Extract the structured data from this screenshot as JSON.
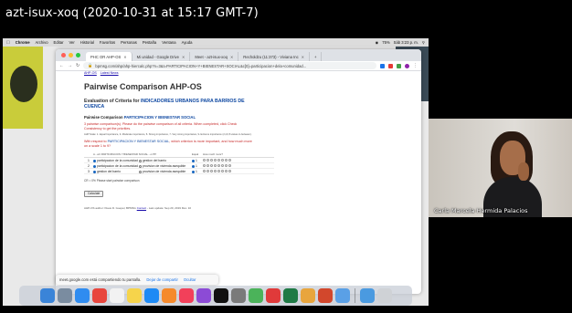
{
  "meeting": {
    "title": "azt-isux-xoq (2020-10-31 at 15:17 GMT-7)",
    "participant_name": "Carla Marcela Hermida Palacios"
  },
  "menubar": {
    "apple": "",
    "items": [
      "Chrome",
      "Archivo",
      "Editar",
      "Ver",
      "Historial",
      "Favoritos",
      "Personas",
      "Pestaña",
      "Ventana",
      "Ayuda"
    ],
    "clock": "Sáb 3:23 p. m.",
    "battery": "75%"
  },
  "browser": {
    "tabs": [
      {
        "label": "PHC OR AHP-OS",
        "active": true
      },
      {
        "label": "Mi unidad - Google Drive",
        "active": false
      },
      {
        "label": "Meet - azt-isux-xoq",
        "active": false
      },
      {
        "label": "Recholdzu (11:373) - Viviana Inc",
        "active": false
      }
    ],
    "new_tab": "+",
    "url": "bpmsg.com/ahp/ahp-hiercalc.php?n=3&t=PARTICIPACION+Y+BIENESTAR+SOCIAL&c[0]=participacion+dela+comunidad..."
  },
  "page": {
    "breadcrumbs": [
      "AHP-OS",
      "Latest News"
    ],
    "title": "Pairwise Comparison AHP-OS",
    "eval_prefix": "Evaluation of Criteria for ",
    "eval_topic": "INDICADORES URBANOS PARA BARRIOS DE CUENCA",
    "pc_prefix": "Pairwise Comparison ",
    "pc_topic": "PARTICIPACION Y BIENESTAR SOCIAL",
    "instructions": "3 pairwise comparison(s). Please do the pairwise comparison of all criteria. When completed, click Check Consistency to get the priorities.",
    "scale": "AHP Scale: 1- Equal Importance, 3- Moderate importance, 5- Strong importance, 7- Very strong importance, 9- Extreme importance (2,4,6,8 values in-between).",
    "question_prefix": "With respect to ",
    "question_topic": "PARTICIPACION Y BIENESTAR SOCIAL",
    "question_suffix": ", which criterion is more important, and how much more on a scale 1 to 9?",
    "table_headers": {
      "a": "A - wrt PARTICIPACION Y BIENESTAR SOCIAL - or B?",
      "eq": "Equal",
      "scale": "How much more?"
    },
    "rows": [
      {
        "n": "1",
        "a": "participacion de la comunidad",
        "b": "gestion del barrio",
        "eq": "1"
      },
      {
        "n": "2",
        "a": "participacion de la comunidad",
        "b": "provision de vivienda asequible",
        "eq": "1"
      },
      {
        "n": "3",
        "a": "gestion del barrio",
        "b": "provision de vivienda asequible",
        "eq": "1"
      }
    ],
    "scale_values": [
      "2",
      "3",
      "4",
      "5",
      "6",
      "7",
      "8",
      "9"
    ],
    "cr_text": "CR = 0% Please start pairwise comparison",
    "calc_button": "Calculate",
    "footer_prefix": "AHP-OS author: Klaus D. Goepel, BPMSG ",
    "footer_link": "Contact",
    "footer_suffix": " - Last update: Sep 20, 2019 Rev: 10"
  },
  "sharebar": {
    "text": "meet.google.com está compartiendo tu pantalla.",
    "stop": "Dejar de compartir",
    "hide": "Ocultar"
  },
  "dock": {
    "icons": [
      "finder-icon",
      "launchpad-icon",
      "safari-icon",
      "chrome-icon",
      "calendar-icon",
      "notes-icon",
      "app-store-icon",
      "photos-icon",
      "music-icon",
      "podcasts-icon",
      "tv-icon",
      "settings-icon",
      "maps-icon",
      "no-entry-icon",
      "excel-icon",
      "chrome-alt-icon",
      "powerpoint-icon",
      "preview-icon",
      "folder-icon",
      "trash-icon"
    ],
    "colors": [
      "#3a84d8",
      "#7a8ca0",
      "#2f8cf0",
      "#e8463d",
      "#f2f2f2",
      "#f6d44b",
      "#1d8af5",
      "#f58a2c",
      "#f2405a",
      "#8c4bd6",
      "#111111",
      "#7a7a7a",
      "#4bb35a",
      "#e03a3a",
      "#1f7a45",
      "#e8a53d",
      "#d2472c",
      "#5aa0e6",
      "#4a9ae0",
      "#cfd2d6"
    ]
  }
}
